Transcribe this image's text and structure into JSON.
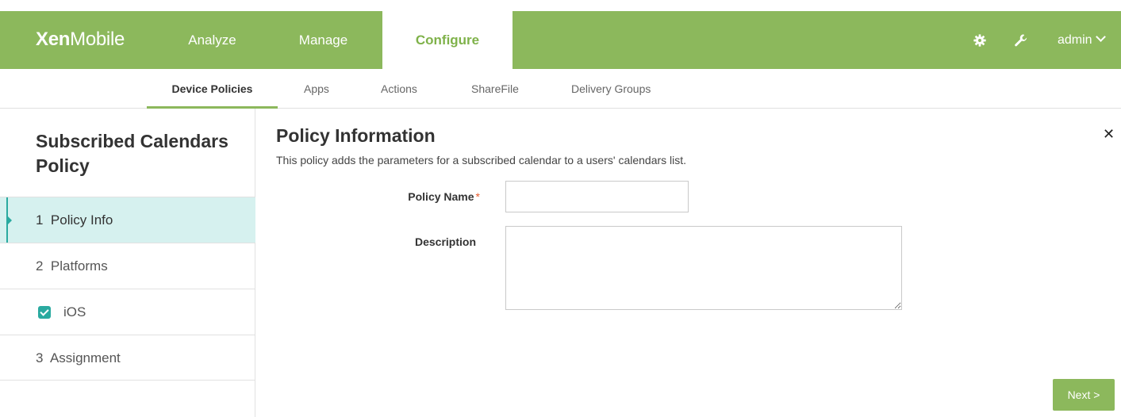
{
  "brand": {
    "logo_bold": "Xen",
    "logo_rest": "Mobile",
    "accent_color": "#8cb85c",
    "teal_color": "#2aaaa0"
  },
  "topnav": {
    "items": [
      {
        "label": "Analyze"
      },
      {
        "label": "Manage"
      },
      {
        "label": "Configure",
        "active": true
      }
    ],
    "icons": [
      "gear-icon",
      "wrench-icon"
    ],
    "user": {
      "label": "admin",
      "icon": "chevron-down-icon"
    }
  },
  "subnav": {
    "items": [
      {
        "label": "Device Policies",
        "active": true
      },
      {
        "label": "Apps"
      },
      {
        "label": "Actions"
      },
      {
        "label": "ShareFile"
      },
      {
        "label": "Delivery Groups"
      }
    ]
  },
  "sidebar": {
    "title": "Subscribed Calendars Policy",
    "steps": [
      {
        "label": "1  Policy Info",
        "active": true
      },
      {
        "label": "2  Platforms"
      },
      {
        "label": "iOS",
        "checked": true
      },
      {
        "label": "3  Assignment"
      }
    ]
  },
  "main": {
    "title": "Policy Information",
    "description": "This policy adds the parameters for a subscribed calendar to a users' calendars list.",
    "close_icon": "close-icon",
    "fields": {
      "policy_name": {
        "label": "Policy Name",
        "required_mark": "*",
        "value": ""
      },
      "description": {
        "label": "Description",
        "value": ""
      }
    },
    "next_label": "Next >"
  }
}
